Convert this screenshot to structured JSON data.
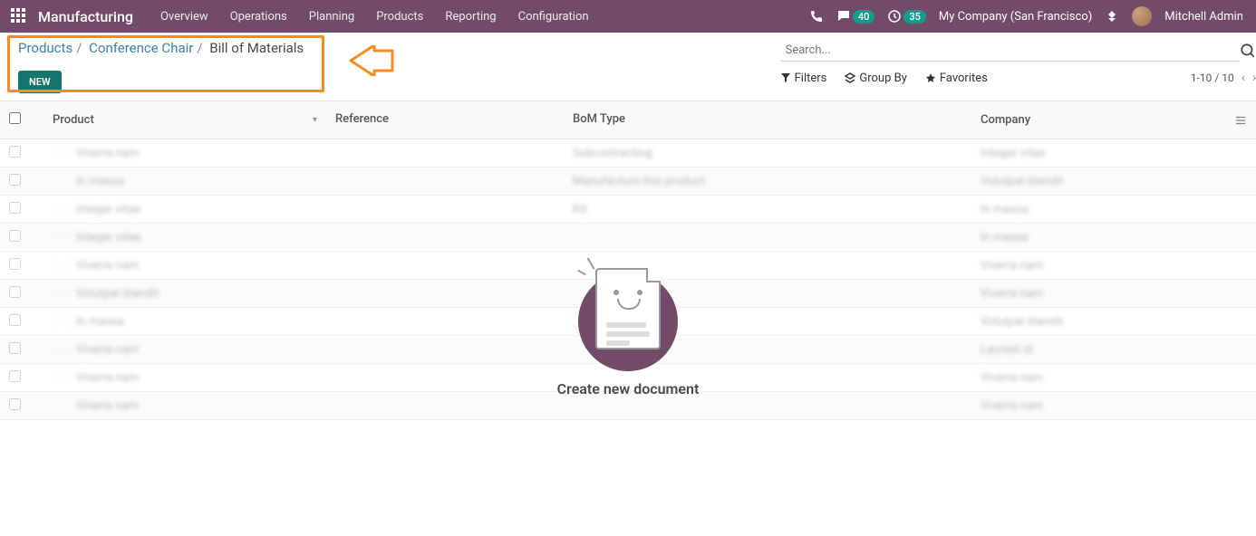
{
  "navbar": {
    "app_name": "Manufacturing",
    "menu": [
      "Overview",
      "Operations",
      "Planning",
      "Products",
      "Reporting",
      "Configuration"
    ],
    "chat_badge": "40",
    "clock_badge": "35",
    "company": "My Company (San Francisco)",
    "user": "Mitchell Admin"
  },
  "breadcrumbs": {
    "parts": [
      "Products",
      "Conference Chair",
      "Bill of Materials"
    ]
  },
  "controls": {
    "new_label": "NEW",
    "search_placeholder": "Search...",
    "filters_label": "Filters",
    "groupby_label": "Group By",
    "favorites_label": "Favorites",
    "pager_text": "1-10 / 10"
  },
  "columns": {
    "product": "Product",
    "reference": "Reference",
    "bom_type": "BoM Type",
    "company": "Company"
  },
  "rows": [
    {
      "product": "Viverra nam",
      "reference": "",
      "bom": "Subcontracting",
      "company": "Integer vitae"
    },
    {
      "product": "In massa",
      "reference": "",
      "bom": "Manufacture this product",
      "company": "Volutpat blandit"
    },
    {
      "product": "Integer vitae",
      "reference": "",
      "bom": "Kit",
      "company": "In massa"
    },
    {
      "product": "Integer vitae",
      "reference": "",
      "bom": "",
      "company": "In massa"
    },
    {
      "product": "Viverra nam",
      "reference": "",
      "bom": "",
      "company": "Viverra nam"
    },
    {
      "product": "Volutpat blandit",
      "reference": "",
      "bom": "",
      "company": "Viverra nam"
    },
    {
      "product": "In massa",
      "reference": "",
      "bom": "",
      "company": "Volutpat blandit"
    },
    {
      "product": "Viverra nam",
      "reference": "",
      "bom": "",
      "company": "Laoreet id"
    },
    {
      "product": "Viverra nam",
      "reference": "",
      "bom": "",
      "company": "Viverra nam"
    },
    {
      "product": "Viverra nam",
      "reference": "",
      "bom": "",
      "company": "Viverra nam"
    }
  ],
  "overlay": {
    "text": "Create new document"
  }
}
